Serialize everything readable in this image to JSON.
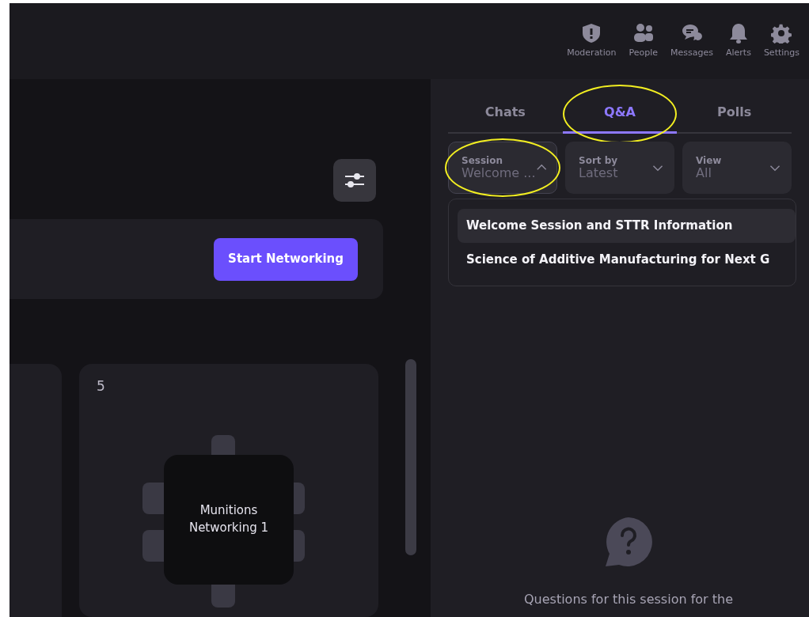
{
  "nav": [
    {
      "label": "Moderation"
    },
    {
      "label": "People"
    },
    {
      "label": "Messages"
    },
    {
      "label": "Alerts"
    },
    {
      "label": "Settings"
    }
  ],
  "networking": {
    "button": "Start Networking"
  },
  "tables": [
    {
      "number": "5",
      "name": "Munitions Networking 1"
    }
  ],
  "tabs": [
    {
      "label": "Chats",
      "selected": false,
      "highlighted": false
    },
    {
      "label": "Q&A",
      "selected": true,
      "highlighted": true
    },
    {
      "label": "Polls",
      "selected": false,
      "highlighted": false
    }
  ],
  "filters": [
    {
      "label": "Session",
      "value": "Welcome ...",
      "expanded": true,
      "highlighted": true
    },
    {
      "label": "Sort by",
      "value": "Latest",
      "expanded": false,
      "highlighted": false
    },
    {
      "label": "View",
      "value": "All",
      "expanded": false,
      "highlighted": false
    }
  ],
  "session_options": [
    {
      "label": "Welcome Session and STTR Information",
      "selected": true
    },
    {
      "label": "Science of Additive Manufacturing for Next G",
      "selected": false
    }
  ],
  "empty_state": {
    "text": "Questions for this session for the"
  }
}
